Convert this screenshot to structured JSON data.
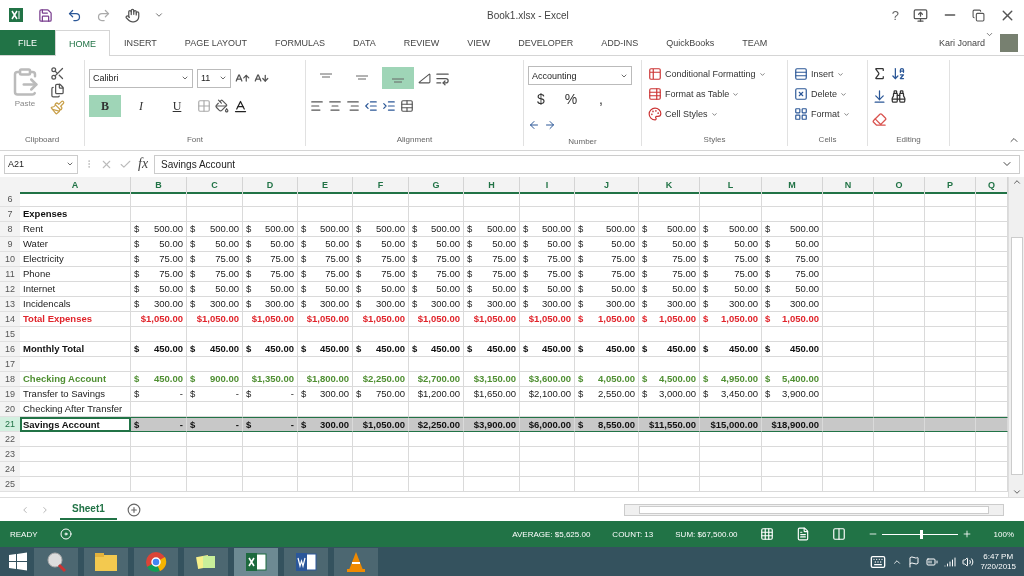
{
  "title_bar": {
    "title": "Book1.xlsx - Excel",
    "help": "?"
  },
  "menu_tabs": [
    {
      "label": "FILE",
      "kind": "file",
      "selected": false
    },
    {
      "label": "HOME",
      "kind": "tab",
      "selected": true
    },
    {
      "label": "INSERT",
      "kind": "tab",
      "selected": false
    },
    {
      "label": "PAGE LAYOUT",
      "kind": "tab",
      "selected": false
    },
    {
      "label": "FORMULAS",
      "kind": "tab",
      "selected": false
    },
    {
      "label": "DATA",
      "kind": "tab",
      "selected": false
    },
    {
      "label": "REVIEW",
      "kind": "tab",
      "selected": false
    },
    {
      "label": "VIEW",
      "kind": "tab",
      "selected": false
    },
    {
      "label": "DEVELOPER",
      "kind": "tab",
      "selected": false
    },
    {
      "label": "ADD-INS",
      "kind": "tab",
      "selected": false
    },
    {
      "label": "QuickBooks",
      "kind": "tab",
      "selected": false
    },
    {
      "label": "TEAM",
      "kind": "tab",
      "selected": false
    }
  ],
  "user": {
    "name": "Kari Jonard"
  },
  "ribbon": {
    "clipboard": {
      "label": "Clipboard",
      "paste": "Paste"
    },
    "font": {
      "label": "Font",
      "font_name": "Calibri",
      "font_size": "11",
      "styles": [
        {
          "label": "B",
          "selected": true
        },
        {
          "label": "I",
          "selected": false
        },
        {
          "label": "U",
          "selected": false
        }
      ]
    },
    "alignment": {
      "label": "Alignment",
      "vertical": [
        {
          "selected": false
        },
        {
          "selected": false
        },
        {
          "selected": true
        }
      ]
    },
    "number": {
      "label": "Number",
      "format": "Accounting",
      "symbols": [
        "$",
        "%",
        ","
      ]
    },
    "styles": {
      "label": "Styles",
      "items": [
        "Conditional Formatting",
        "Format as Table",
        "Cell Styles"
      ]
    },
    "cells": {
      "label": "Cells",
      "items": [
        "Insert",
        "Delete",
        "Format"
      ]
    },
    "editing": {
      "label": "Editing"
    }
  },
  "formula_bar": {
    "name_box": "A21",
    "fx": "fx",
    "formula": "Savings Account"
  },
  "columns": [
    "A",
    "B",
    "C",
    "D",
    "E",
    "F",
    "G",
    "H",
    "I",
    "J",
    "K",
    "L",
    "M",
    "N",
    "O",
    "P",
    "Q"
  ],
  "rows": [
    {
      "number": "6",
      "kind": "plain",
      "selected": false
    },
    {
      "number": "7",
      "label": "Expenses",
      "kind": "bold",
      "selected": false
    },
    {
      "number": "8",
      "label": "Rent",
      "kind": "plain",
      "selected": false,
      "cells": [
        [
          "$",
          "500.00"
        ],
        [
          "$",
          "500.00"
        ],
        [
          "$",
          "500.00"
        ],
        [
          "$",
          "500.00"
        ],
        [
          "$",
          "500.00"
        ],
        [
          "$",
          "500.00"
        ],
        [
          "$",
          "500.00"
        ],
        [
          "$",
          "500.00"
        ],
        [
          "$",
          "500.00"
        ],
        [
          "$",
          "500.00"
        ],
        [
          "$",
          "500.00"
        ],
        [
          "$",
          "500.00"
        ]
      ]
    },
    {
      "number": "9",
      "label": "Water",
      "kind": "plain",
      "selected": false,
      "cells": [
        [
          "$",
          "50.00"
        ],
        [
          "$",
          "50.00"
        ],
        [
          "$",
          "50.00"
        ],
        [
          "$",
          "50.00"
        ],
        [
          "$",
          "50.00"
        ],
        [
          "$",
          "50.00"
        ],
        [
          "$",
          "50.00"
        ],
        [
          "$",
          "50.00"
        ],
        [
          "$",
          "50.00"
        ],
        [
          "$",
          "50.00"
        ],
        [
          "$",
          "50.00"
        ],
        [
          "$",
          "50.00"
        ]
      ]
    },
    {
      "number": "10",
      "label": "Electricity",
      "kind": "plain",
      "selected": false,
      "cells": [
        [
          "$",
          "75.00"
        ],
        [
          "$",
          "75.00"
        ],
        [
          "$",
          "75.00"
        ],
        [
          "$",
          "75.00"
        ],
        [
          "$",
          "75.00"
        ],
        [
          "$",
          "75.00"
        ],
        [
          "$",
          "75.00"
        ],
        [
          "$",
          "75.00"
        ],
        [
          "$",
          "75.00"
        ],
        [
          "$",
          "75.00"
        ],
        [
          "$",
          "75.00"
        ],
        [
          "$",
          "75.00"
        ]
      ]
    },
    {
      "number": "11",
      "label": "Phone",
      "kind": "plain",
      "selected": false,
      "cells": [
        [
          "$",
          "75.00"
        ],
        [
          "$",
          "75.00"
        ],
        [
          "$",
          "75.00"
        ],
        [
          "$",
          "75.00"
        ],
        [
          "$",
          "75.00"
        ],
        [
          "$",
          "75.00"
        ],
        [
          "$",
          "75.00"
        ],
        [
          "$",
          "75.00"
        ],
        [
          "$",
          "75.00"
        ],
        [
          "$",
          "75.00"
        ],
        [
          "$",
          "75.00"
        ],
        [
          "$",
          "75.00"
        ]
      ]
    },
    {
      "number": "12",
      "label": "Internet",
      "kind": "plain",
      "selected": false,
      "cells": [
        [
          "$",
          "50.00"
        ],
        [
          "$",
          "50.00"
        ],
        [
          "$",
          "50.00"
        ],
        [
          "$",
          "50.00"
        ],
        [
          "$",
          "50.00"
        ],
        [
          "$",
          "50.00"
        ],
        [
          "$",
          "50.00"
        ],
        [
          "$",
          "50.00"
        ],
        [
          "$",
          "50.00"
        ],
        [
          "$",
          "50.00"
        ],
        [
          "$",
          "50.00"
        ],
        [
          "$",
          "50.00"
        ]
      ]
    },
    {
      "number": "13",
      "label": "Incidencals",
      "kind": "plain",
      "selected": false,
      "cells": [
        [
          "$",
          "300.00"
        ],
        [
          "$",
          "300.00"
        ],
        [
          "$",
          "300.00"
        ],
        [
          "$",
          "300.00"
        ],
        [
          "$",
          "300.00"
        ],
        [
          "$",
          "300.00"
        ],
        [
          "$",
          "300.00"
        ],
        [
          "$",
          "300.00"
        ],
        [
          "$",
          "300.00"
        ],
        [
          "$",
          "300.00"
        ],
        [
          "$",
          "300.00"
        ],
        [
          "$",
          "300.00"
        ]
      ]
    },
    {
      "number": "14",
      "label": "Total Expenses",
      "kind": "total",
      "selected": false,
      "cells": [
        "$1,050.00",
        "$1,050.00",
        "$1,050.00",
        "$1,050.00",
        "$1,050.00",
        "$1,050.00",
        "$1,050.00",
        "$1,050.00",
        [
          "$",
          "1,050.00"
        ],
        [
          "$",
          "1,050.00"
        ],
        [
          "$",
          "1,050.00"
        ],
        [
          "$",
          "1,050.00"
        ]
      ]
    },
    {
      "number": "15",
      "kind": "plain",
      "selected": false
    },
    {
      "number": "16",
      "label": "Monthly Total",
      "kind": "bold",
      "selected": false,
      "cells": [
        [
          "$",
          "450.00"
        ],
        [
          "$",
          "450.00"
        ],
        [
          "$",
          "450.00"
        ],
        [
          "$",
          "450.00"
        ],
        [
          "$",
          "450.00"
        ],
        [
          "$",
          "450.00"
        ],
        [
          "$",
          "450.00"
        ],
        [
          "$",
          "450.00"
        ],
        [
          "$",
          "450.00"
        ],
        [
          "$",
          "450.00"
        ],
        [
          "$",
          "450.00"
        ],
        [
          "$",
          "450.00"
        ]
      ]
    },
    {
      "number": "17",
      "kind": "plain",
      "selected": false
    },
    {
      "number": "18",
      "label": "Checking Account",
      "kind": "checking",
      "selected": false,
      "cells": [
        [
          "$",
          "450.00"
        ],
        [
          "$",
          "900.00"
        ],
        "$1,350.00",
        "$1,800.00",
        "$2,250.00",
        "$2,700.00",
        "$3,150.00",
        "$3,600.00",
        [
          "$",
          "4,050.00"
        ],
        [
          "$",
          "4,500.00"
        ],
        [
          "$",
          "4,950.00"
        ],
        [
          "$",
          "5,400.00"
        ]
      ]
    },
    {
      "number": "19",
      "label": "Transfer to Savings",
      "kind": "plain",
      "selected": false,
      "cells": [
        [
          "$",
          "-"
        ],
        [
          "$",
          "-"
        ],
        [
          "$",
          "-"
        ],
        [
          "$",
          "300.00"
        ],
        [
          "$",
          "750.00"
        ],
        "$1,200.00",
        "$1,650.00",
        "$2,100.00",
        [
          "$",
          "2,550.00"
        ],
        [
          "$",
          "3,000.00"
        ],
        [
          "$",
          "3,450.00"
        ],
        [
          "$",
          "3,900.00"
        ]
      ]
    },
    {
      "number": "20",
      "label": "Checking After Transfer",
      "kind": "plain",
      "selected": false
    },
    {
      "number": "21",
      "label": "Savings Account",
      "kind": "bold",
      "selected": true,
      "cells": [
        [
          "$",
          "-"
        ],
        [
          "$",
          "-"
        ],
        [
          "$",
          "-"
        ],
        [
          "$",
          "300.00"
        ],
        "$1,050.00",
        "$2,250.00",
        "$3,900.00",
        "$6,000.00",
        [
          "$",
          "8,550.00"
        ],
        "$11,550.00",
        "$15,000.00",
        "$18,900.00"
      ]
    },
    {
      "number": "22",
      "kind": "plain",
      "selected": false
    },
    {
      "number": "23",
      "kind": "plain",
      "selected": false
    },
    {
      "number": "24",
      "kind": "plain",
      "selected": false
    },
    {
      "number": "25",
      "kind": "plain",
      "selected": false
    }
  ],
  "sheet_tabs": [
    {
      "label": "Sheet1",
      "selected": true
    }
  ],
  "status_bar": {
    "mode": "READY",
    "stats": [
      "AVERAGE: $5,625.00",
      "COUNT: 13",
      "SUM: $67,500.00"
    ],
    "zoom": "100%",
    "zoom_level": {
      "level": 0.5
    }
  },
  "taskbar": {
    "apps": [
      {
        "kind": "tool",
        "selected": false
      },
      {
        "kind": "folder",
        "selected": false
      },
      {
        "kind": "browser",
        "selected": false
      },
      {
        "kind": "notes",
        "selected": false
      },
      {
        "kind": "sheet",
        "selected": true
      },
      {
        "kind": "doc",
        "selected": false
      },
      {
        "kind": "cone",
        "selected": false
      }
    ],
    "time": "6:47 PM",
    "date": "7/20/2015"
  }
}
